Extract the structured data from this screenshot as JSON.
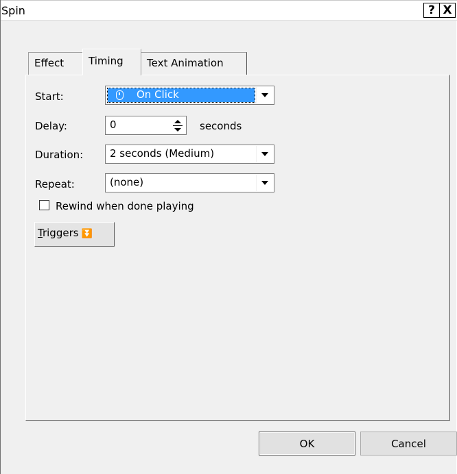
{
  "window": {
    "title": "Spin",
    "help_label": "?",
    "close_label": "X"
  },
  "tabs": [
    {
      "label": "Effect",
      "active": false
    },
    {
      "label": "Timing",
      "active": true
    },
    {
      "label": "Text Animation",
      "active": false
    }
  ],
  "timing": {
    "start_label": "Start:",
    "start_value": "On Click",
    "delay_label": "Delay:",
    "delay_value": "0",
    "delay_unit": "seconds",
    "duration_label": "Duration:",
    "duration_value": "2 seconds (Medium)",
    "repeat_label": "Repeat:",
    "repeat_value": "(none)",
    "rewind_label": "Rewind when done playing",
    "rewind_checked": false,
    "triggers_label_u": "T",
    "triggers_label_rest": "riggers"
  },
  "buttons": {
    "ok": "OK",
    "cancel": "Cancel"
  },
  "icons": {
    "start": "mouse-icon",
    "help": "help-icon",
    "close": "close-icon",
    "triggers": "double-chevron-down-icon"
  }
}
